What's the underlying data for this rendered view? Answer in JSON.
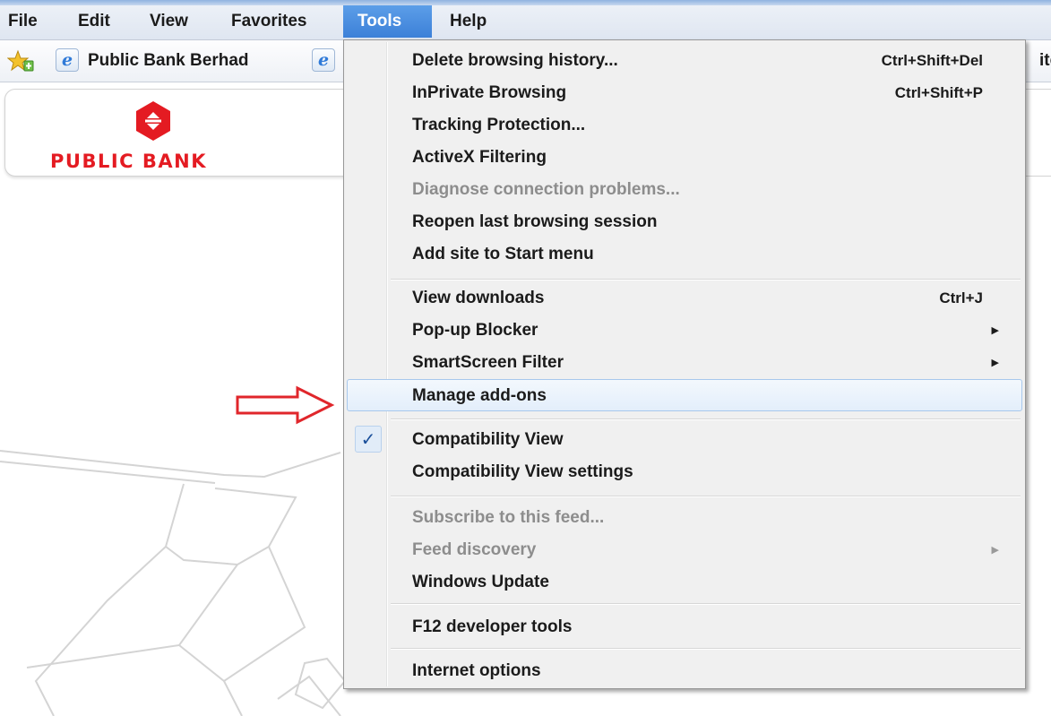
{
  "menubar": {
    "items": [
      {
        "label": "File"
      },
      {
        "label": "Edit"
      },
      {
        "label": "View"
      },
      {
        "label": "Favorites"
      },
      {
        "label": "Tools",
        "active": true
      },
      {
        "label": "Help"
      }
    ]
  },
  "favorites_bar": {
    "link_label": "Public Bank Berhad",
    "ie_icon_glyph": "e",
    "clipped_text": "ite",
    "icons": [
      "favorites-star-icon",
      "ie-page-icon"
    ]
  },
  "page": {
    "logo_text": "PUBLIC BANK",
    "logo_color": "#e41b22"
  },
  "tools_menu": {
    "items": [
      {
        "label": "Delete browsing history...",
        "shortcut": "Ctrl+Shift+Del",
        "enabled": true
      },
      {
        "label": "InPrivate Browsing",
        "shortcut": "Ctrl+Shift+P",
        "enabled": true
      },
      {
        "label": "Tracking Protection...",
        "enabled": true
      },
      {
        "label": "ActiveX Filtering",
        "enabled": true
      },
      {
        "label": "Diagnose connection problems...",
        "enabled": false
      },
      {
        "label": "Reopen last browsing session",
        "enabled": true
      },
      {
        "label": "Add site to Start menu",
        "enabled": true
      },
      {
        "label": "View downloads",
        "shortcut": "Ctrl+J",
        "enabled": true
      },
      {
        "label": "Pop-up Blocker",
        "submenu": true,
        "enabled": true
      },
      {
        "label": "SmartScreen Filter",
        "submenu": true,
        "enabled": true
      },
      {
        "label": "Manage add-ons",
        "enabled": true,
        "highlighted": true
      },
      {
        "label": "Compatibility View",
        "checked": true,
        "enabled": true
      },
      {
        "label": "Compatibility View settings",
        "enabled": true
      },
      {
        "label": "Subscribe to this feed...",
        "enabled": false
      },
      {
        "label": "Feed discovery",
        "submenu": true,
        "enabled": false
      },
      {
        "label": "Windows Update",
        "enabled": true
      },
      {
        "label": "F12 developer tools",
        "enabled": true
      },
      {
        "label": "Internet options",
        "enabled": true
      }
    ],
    "submenu_glyph": "▶",
    "check_glyph": "✓"
  },
  "annotation": {
    "arrow_color": "#e0262b",
    "points_to": "Manage add-ons"
  },
  "colors": {
    "menu_active_bg": "#3c80d8",
    "menu_bg": "#f0f0f0",
    "highlight_border": "#a8c8ec",
    "disabled_text": "#8d8d8d"
  }
}
